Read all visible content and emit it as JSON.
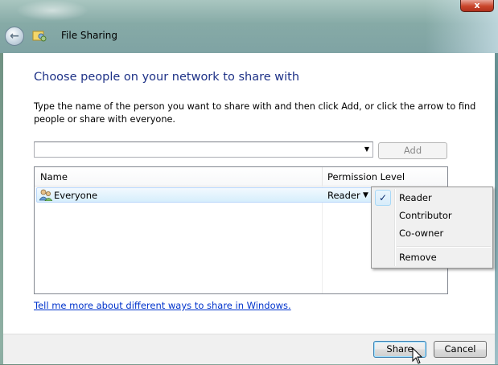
{
  "window": {
    "title": "File Sharing",
    "close_label": "x"
  },
  "main": {
    "heading": "Choose people on your network to share with",
    "instructions": "Type the name of the person you want to share with and then click Add, or click the arrow to find people or share with everyone.",
    "name_input": {
      "value": "",
      "placeholder": ""
    },
    "add_label": "Add",
    "columns": {
      "name": "Name",
      "permission": "Permission Level"
    },
    "rows": [
      {
        "name": "Everyone",
        "permission": "Reader"
      }
    ],
    "help_link": "Tell me more about different ways to share in Windows."
  },
  "menu": {
    "items": [
      {
        "label": "Reader",
        "checked": true
      },
      {
        "label": "Contributor",
        "checked": false
      },
      {
        "label": "Co-owner",
        "checked": false
      },
      {
        "label": "Remove",
        "checked": false
      }
    ]
  },
  "footer": {
    "share_label": "Share",
    "cancel_label": "Cancel"
  },
  "colors": {
    "heading": "#1e3287",
    "link": "#0033cc",
    "selection": "#d6eefc"
  }
}
